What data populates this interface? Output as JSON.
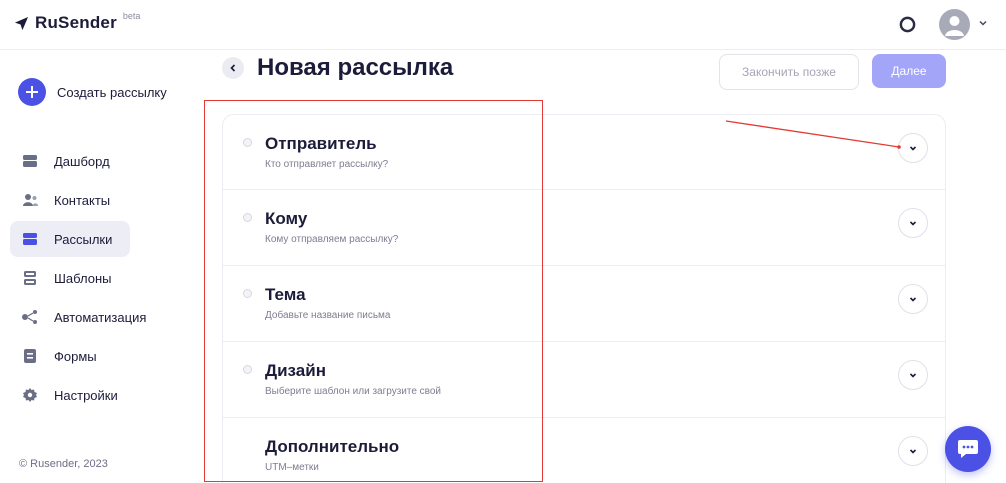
{
  "header": {
    "logo_text": "RuSender",
    "beta_label": "beta"
  },
  "sidebar": {
    "create_label": "Создать рассылку",
    "items": [
      {
        "label": "Дашборд",
        "icon": "dashboard-icon"
      },
      {
        "label": "Контакты",
        "icon": "contacts-icon"
      },
      {
        "label": "Рассылки",
        "icon": "mailing-icon",
        "active": true
      },
      {
        "label": "Шаблоны",
        "icon": "templates-icon"
      },
      {
        "label": "Автоматизация",
        "icon": "automation-icon"
      },
      {
        "label": "Формы",
        "icon": "forms-icon"
      },
      {
        "label": "Настройки",
        "icon": "settings-icon"
      }
    ],
    "copyright": "© Rusender, 2023"
  },
  "main": {
    "title": "Новая рассылка",
    "later_label": "Закончить позже",
    "next_label": "Далее",
    "sections": [
      {
        "title": "Отправитель",
        "subtitle": "Кто отправляет рассылку?"
      },
      {
        "title": "Кому",
        "subtitle": "Кому отправляем рассылку?"
      },
      {
        "title": "Тема",
        "subtitle": "Добавьте название письма"
      },
      {
        "title": "Дизайн",
        "subtitle": "Выберите шаблон или загрузите свой"
      },
      {
        "title": "Дополнительно",
        "subtitle": "UTM–метки"
      }
    ]
  },
  "colors": {
    "accent": "#4c51e6",
    "accent_light": "#a3a6f8",
    "annotation": "#e53935"
  }
}
